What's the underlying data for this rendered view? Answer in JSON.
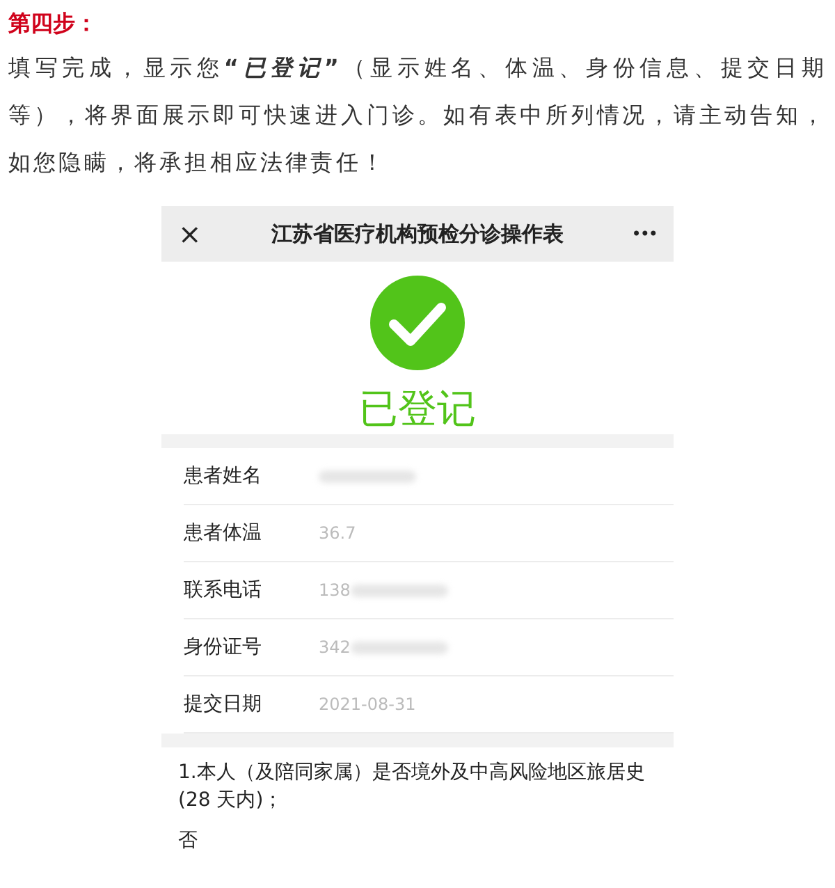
{
  "step_heading": "第四步：",
  "paragraph": "填写完成，显示您**“*已登记*”**（显示姓名、体温、身份信息、提交日期等），将界面展示即可快速进入门诊。如有表中所列情况，请主动告知，如您隐瞒，将承担相应法律责任！",
  "phone": {
    "nav_title": "江苏省医疗机构预检分诊操作表",
    "close": "×",
    "more": "•••",
    "status": {
      "kind": "success",
      "text": "已登记"
    },
    "fields": [
      {
        "label": "患者姓名",
        "blurred": true
      },
      {
        "label": "患者体温",
        "value": "36.7",
        "blurred": false
      },
      {
        "label": "联系电话",
        "value": "138",
        "blurred": true
      },
      {
        "label": "身份证号",
        "value": "342",
        "blurred": true
      },
      {
        "label": "提交日期",
        "value": "2021-08-31",
        "blurred": false
      }
    ],
    "questions": [
      {
        "text": "1.本人（及陪同家属）是否境外及中高风险地区旅居史(28 天内)；",
        "answer": "否"
      }
    ]
  }
}
